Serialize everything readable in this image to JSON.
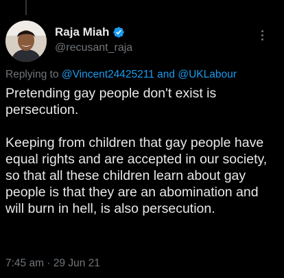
{
  "author": {
    "display_name": "Raja Miah",
    "handle": "@recusant_raja",
    "verified": true,
    "verified_color": "#1d9bf0"
  },
  "reply": {
    "prefix": "Replying to",
    "mentions": [
      "@Vincent24425211",
      "@UKLabour"
    ],
    "joiner": "and"
  },
  "tweet": {
    "paragraphs": [
      "Pretending gay people don't exist is persecution.",
      "Keeping from children that gay people have equal rights and are accepted in our society, so that all these children learn about gay people is that they are an abomination and will burn in hell, is also persecution."
    ]
  },
  "meta": {
    "timestamp": "7:45 am · 29 Jun 21"
  },
  "colors": {
    "background": "#000000",
    "text": "#e7e9ea",
    "secondary": "#71767b",
    "link": "#1d9bf0"
  },
  "icons": {
    "verified": "verified-badge-icon",
    "more": "more-options-icon"
  }
}
